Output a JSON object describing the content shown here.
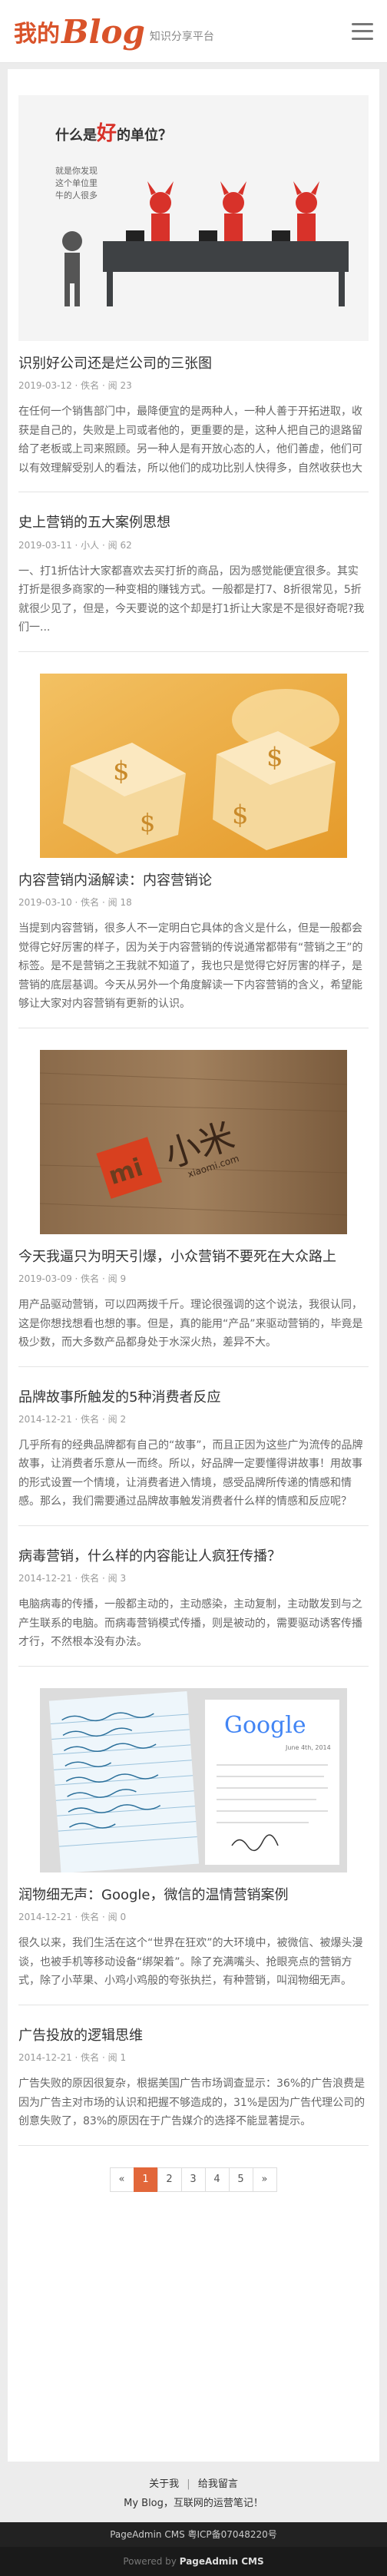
{
  "header": {
    "logo_text": "我的",
    "logo_blog": "Blog",
    "logo_sub": "知识分享平台"
  },
  "hero": {
    "headline_pre": "什么是",
    "headline_hl": "好",
    "headline_post": "的单位？",
    "lines": [
      "就是你发现",
      "这个单位里",
      "牛的人很多"
    ]
  },
  "articles": [
    {
      "title": "识别好公司还是烂公司的三张图",
      "meta": "2019-03-12 · 佚名 · 阅 23",
      "summary": "在任何一个销售部门中，最降便宜的是两种人，一种人善于开拓进取，收获是自己的，失败是上司或者他的，更重要的是，这种人把自己的退路留给了老板或上司来照顾。另一种人是有开放心态的人，他们善虚，他们可以有效理解受别人的看法，所以他们的成功比别人快得多，自然收获也大"
    },
    {
      "title": "史上营销的五大案例思想",
      "meta": "2019-03-11 · 小人 · 阅 62",
      "summary": "一、打1折估计大家都喜欢去买打折的商品，因为感觉能便宜很多。其实打折是很多商家的一种变相的赚钱方式。一般都是打7、8折很常见，5折就很少见了，但是，今天要说的这个却是打1折让大家是不是很好奇呢?我们一..."
    },
    {
      "title": "内容营销内涵解读：内容营销论",
      "meta": "2019-03-10 · 佚名 · 阅 18",
      "summary": "当提到内容营销，很多人不一定明白它具体的含义是什么，但是一般都会觉得它好厉害的样子，因为关于内容营销的传说通常都带有“营销之王”的标签。是不是营销之王我就不知道了，我也只是觉得它好厉害的样子，是营销的底层基调。今天从另外一个角度解读一下内容营销的含义，希望能够让大家对内容营销有更新的认识。"
    },
    {
      "title": "今天我逼只为明天引爆，小众营销不要死在大众路上",
      "meta": "2019-03-09 · 佚名 · 阅 9",
      "summary": "用产品驱动营销，可以四两拨千斤。理论很强调的这个说法，我很认同，这是你想找想看也想的事。但是，真的能用“产品”来驱动营销的，毕竟是极少数，而大多数产品都身处于水深火热，差异不大。"
    },
    {
      "title": "品牌故事所触发的5种消费者反应",
      "meta": "2014-12-21 · 佚名 · 阅 2",
      "summary": "几乎所有的经典品牌都有自己的“故事”，而且正因为这些广为流传的品牌故事，让消费者乐意从一而终。所以，好品牌一定要懂得讲故事！用故事的形式设置一个情境，让消费者进入情境，感受品牌所传递的情感和情感。那么，我们需要通过品牌故事触发消费者什么样的情感和反应呢？"
    },
    {
      "title": "病毒营销，什么样的内容能让人疯狂传播？",
      "meta": "2014-12-21 · 佚名 · 阅 3",
      "summary": "电脑病毒的传播，一般都主动的，主动感染，主动复制，主动散发到与之产生联系的电脑。而病毒营销模式传播，则是被动的，需要驱动诱客传播才行，不然根本没有办法。"
    },
    {
      "title": "润物细无声：Google，微信的温情营销案例",
      "meta": "2014-12-21 · 佚名 · 阅 0",
      "summary": "很久以来，我们生活在这个“世界在狂欢”的大环境中，被微信、被爆头漫谈，也被手机等移动设备“绑架着”。除了充满嘴头、抢眼亮点的营销方式，除了小苹果、小鸡小鸡般的夸张执拦，有种营销，叫润物细无声。"
    },
    {
      "title": "广告投放的逻辑思维",
      "meta": "2014-12-21 · 佚名 · 阅 1",
      "summary": "广告失败的原因很复杂，根据美国广告市场调查显示：36%的广告浪费是因为广告主对市场的认识和把握不够造成的，31%是因为广告代理公司的创意失败了，83%的原因在于广告媒介的选择不能显著提示。"
    }
  ],
  "images": {
    "mi_logo": "mi",
    "mi_chars": "小米",
    "mi_url": "xiaomi.com",
    "google_word": "Google",
    "google_date": "June 4th, 2014"
  },
  "pagination": {
    "prev": "«",
    "pages": [
      "1",
      "2",
      "3",
      "4",
      "5"
    ],
    "next": "»"
  },
  "footer": {
    "about": "关于我",
    "guestbook": "给我留言",
    "sep": "|",
    "slogan": "My Blog，互联网的运营笔记！",
    "copyright": "PageAdmin CMS 粤ICP备07048220号",
    "powered_pre": "Powered by",
    "powered_brand": "PageAdmin CMS"
  },
  "colors": {
    "accent": "#e2673a",
    "logo": "#d9532a",
    "devil": "#d8322a"
  }
}
